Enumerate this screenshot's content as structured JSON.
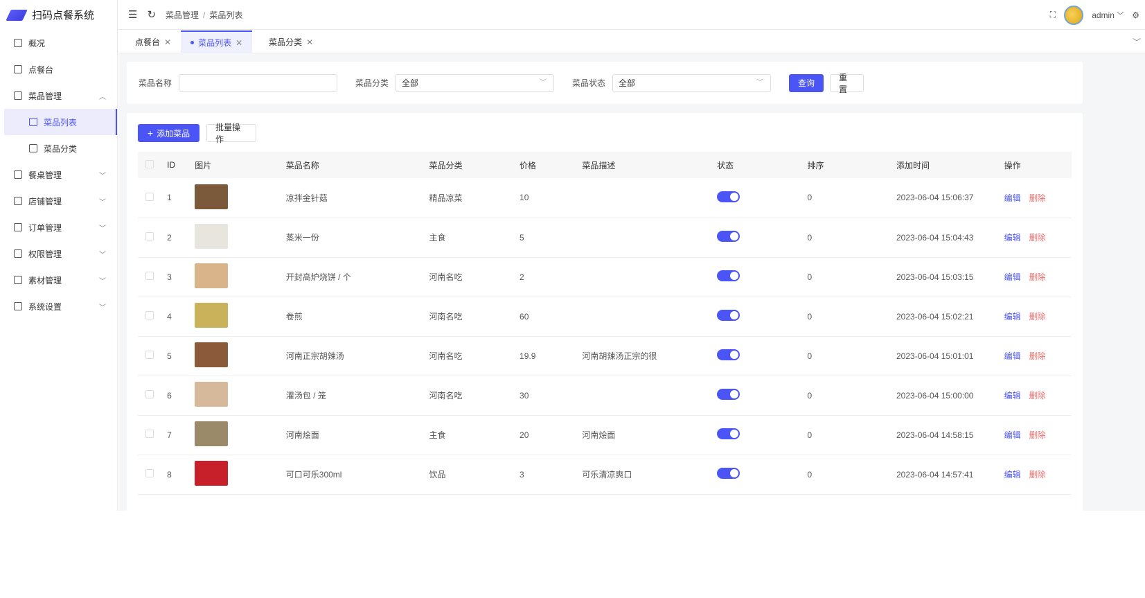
{
  "app": {
    "title": "扫码点餐系统"
  },
  "sidebar": {
    "items": [
      {
        "label": "概况",
        "icon": "chart-icon"
      },
      {
        "label": "点餐台",
        "icon": "monitor-icon"
      },
      {
        "label": "菜品管理",
        "icon": "message-icon",
        "expanded": true,
        "children": [
          {
            "label": "菜品列表",
            "active": true
          },
          {
            "label": "菜品分类"
          }
        ]
      },
      {
        "label": "餐桌管理",
        "icon": "fork-knife-icon"
      },
      {
        "label": "店铺管理",
        "icon": "shop-icon"
      },
      {
        "label": "订单管理",
        "icon": "order-icon"
      },
      {
        "label": "权限管理",
        "icon": "lock-icon"
      },
      {
        "label": "素材管理",
        "icon": "image-icon"
      },
      {
        "label": "系统设置",
        "icon": "gear-icon"
      }
    ]
  },
  "header": {
    "breadcrumb": [
      "菜品管理",
      "菜品列表"
    ],
    "user": "admin"
  },
  "tabs": [
    {
      "label": "点餐台"
    },
    {
      "label": "菜品列表",
      "active": true
    },
    {
      "label": "菜品分类"
    }
  ],
  "filter": {
    "name_label": "菜品名称",
    "name_value": "",
    "category_label": "菜品分类",
    "category_value": "全部",
    "status_label": "菜品状态",
    "status_value": "全部",
    "query": "查询",
    "reset": "重置"
  },
  "toolbar": {
    "add": "添加菜品",
    "batch": "批量操作"
  },
  "table": {
    "headers": [
      "ID",
      "图片",
      "菜品名称",
      "菜品分类",
      "价格",
      "菜品描述",
      "状态",
      "排序",
      "添加时间",
      "操作"
    ],
    "edit": "编辑",
    "delete": "删除",
    "rows": [
      {
        "id": "1",
        "name": "凉拌金针菇",
        "category": "精品凉菜",
        "price": "10",
        "desc": "",
        "status": true,
        "sort": "0",
        "time": "2023-06-04 15:06:37",
        "color": "#7a5a3a"
      },
      {
        "id": "2",
        "name": "蒸米一份",
        "category": "主食",
        "price": "5",
        "desc": "",
        "status": true,
        "sort": "0",
        "time": "2023-06-04 15:04:43",
        "color": "#e8e4de"
      },
      {
        "id": "3",
        "name": "开封高炉烧饼 / 个",
        "category": "河南名吃",
        "price": "2",
        "desc": "",
        "status": true,
        "sort": "0",
        "time": "2023-06-04 15:03:15",
        "color": "#d9b48a"
      },
      {
        "id": "4",
        "name": "卷煎",
        "category": "河南名吃",
        "price": "60",
        "desc": "",
        "status": true,
        "sort": "0",
        "time": "2023-06-04 15:02:21",
        "color": "#c9b25a"
      },
      {
        "id": "5",
        "name": "河南正宗胡辣汤",
        "category": "河南名吃",
        "price": "19.9",
        "desc": "河南胡辣汤正宗的很",
        "status": true,
        "sort": "0",
        "time": "2023-06-04 15:01:01",
        "color": "#8a5a3a"
      },
      {
        "id": "6",
        "name": "灌汤包 / 笼",
        "category": "河南名吃",
        "price": "30",
        "desc": "",
        "status": true,
        "sort": "0",
        "time": "2023-06-04 15:00:00",
        "color": "#d6b89a"
      },
      {
        "id": "7",
        "name": "河南烩面",
        "category": "主食",
        "price": "20",
        "desc": "河南烩面",
        "status": true,
        "sort": "0",
        "time": "2023-06-04 14:58:15",
        "color": "#9a8a6a"
      },
      {
        "id": "8",
        "name": "可口可乐300ml",
        "category": "饮品",
        "price": "3",
        "desc": "可乐清凉爽口",
        "status": true,
        "sort": "0",
        "time": "2023-06-04 14:57:41",
        "color": "#c8202a"
      }
    ]
  }
}
